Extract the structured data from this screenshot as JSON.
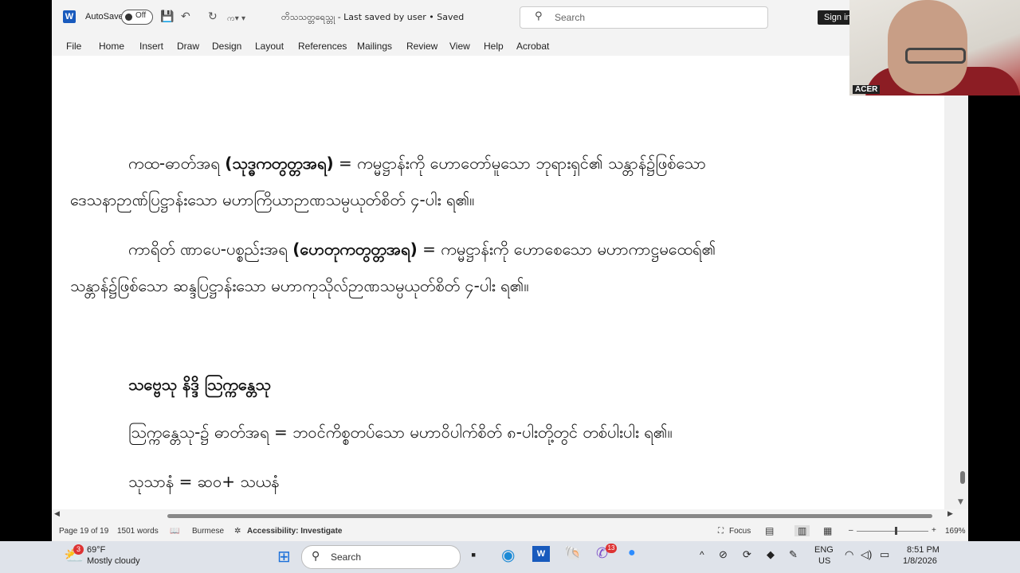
{
  "titlebar": {
    "autosave_label": "AutoSave",
    "autosave_state": "Off",
    "doc_title": "တိသသတ္တရေသ္တု - Last saved by user • Saved",
    "search_placeholder": "Search",
    "signin_label": "Sign in"
  },
  "menu": [
    "File",
    "Home",
    "Insert",
    "Draw",
    "Design",
    "Layout",
    "References",
    "Mailings",
    "Review",
    "View",
    "Help",
    "Acrobat"
  ],
  "document": {
    "p1_a": "ကထ-ဓာတ်အရ",
    "p1_b": "(သုဒ္ဓကတွတ္တအရ)",
    "p1_c": "= ကမ္မဋ္ဌာန်းကို ဟောတော်မူသော ဘုရားရှင်၏ သန္တာန်၌ဖြစ်သော",
    "p1_d": "ဒေသနာဉာဏ်ပြဋ္ဌာန်းသော မဟာကြိယာဉာဏသမ္ပယုတ်စိတ် ၄-ပါး ရ၏။",
    "p2_a": "ကာရိတ် ဏာပေ-ပစ္စည်းအရ",
    "p2_b": "(ဟေတုကတွတ္တအရ)",
    "p2_c": "= ကမ္မဋ္ဌာန်းကို ဟောစေသော မဟာကာဋ္ဌမထေရ်၏",
    "p2_d": "သန္တာန်၌ဖြစ်သော ဆန္ဒပြဋ္ဌာန်းသော မဟာကုသိုလ်ဉာဏသမ္ပယုတ်စိတ် ၄-ပါး ရ၏။",
    "heading": "သဗ္ဗေသု နိဒ္ဒိ သြက္ကန္တေသု",
    "p3": "သြက္ကန္တေသု-၌ ဓာတ်အရ = ဘဝင်ကိစ္စတပ်သော မဟာဝိပါက်စိတ် ၈-ပါးတို့တွင် တစ်ပါးပါး ရ၏။",
    "p4": "သုသာနံ = ဆ၀+ သယနံ"
  },
  "statusbar": {
    "page": "Page 19 of 19",
    "words": "1501 words",
    "language": "Burmese",
    "accessibility": "Accessibility: Investigate",
    "focus": "Focus",
    "zoom": "169%"
  },
  "webcam": {
    "label": "ACER"
  },
  "taskbar": {
    "badge": "3",
    "temp": "69°F",
    "weather": "Mostly cloudy",
    "search": "Search",
    "viber_badge": "13",
    "lang1": "ENG",
    "lang2": "US",
    "time": "8:51 PM",
    "date": "1/8/2026"
  }
}
